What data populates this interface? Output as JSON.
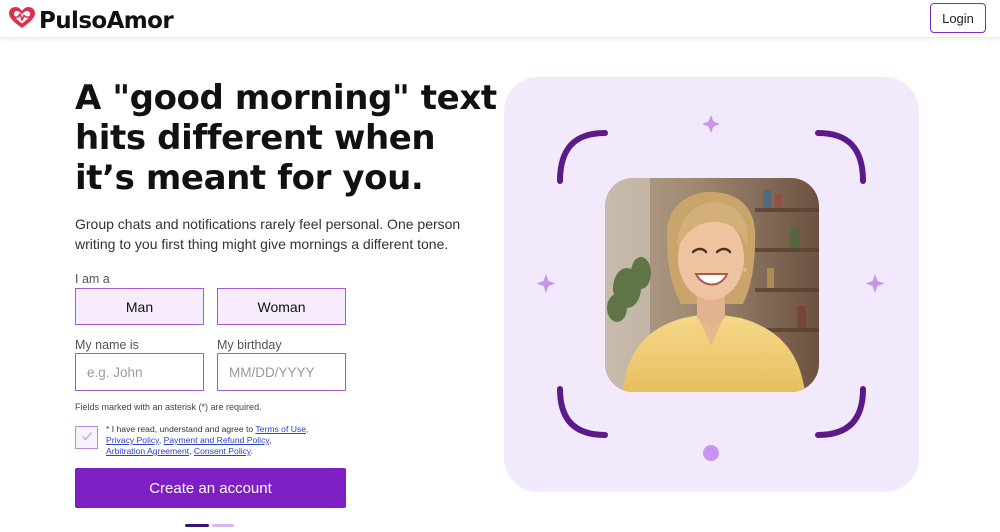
{
  "header": {
    "brand": "PulsoAmor",
    "login_label": "Login",
    "logo_icon": "heart-pulse-icon",
    "brand_color": "#e0304f"
  },
  "hero": {
    "headline": "A \"good morning\" text hits different when it’s meant for you.",
    "subtext": "Group chats and notifications rarely feel personal. One person writing to you first thing might give mornings a different tone."
  },
  "form": {
    "gender_label": "I am a",
    "gender_options": [
      "Man",
      "Woman"
    ],
    "name_label": "My name is",
    "name_placeholder": "e.g. John",
    "name_value": "",
    "birthday_label": "My birthday",
    "birthday_placeholder": "MM/DD/YYYY",
    "birthday_value": "",
    "required_note": "Fields marked with an asterisk (*) are required.",
    "agree_prefix": "* I have read, understand and agree to ",
    "links": {
      "terms": "Terms of Use",
      "privacy": "Privacy Policy",
      "payment": "Payment and Refund Policy",
      "arbitration": "Arbitration Agreement",
      "consent": "Consent Policy"
    },
    "agreement_checked": false,
    "submit_label": "Create an account",
    "accent_color": "#7e1fc6"
  },
  "steps": {
    "current": 1,
    "total": 2
  },
  "visual": {
    "background_color": "#f3e9fd",
    "bracket_color": "#5a1a8a",
    "sparkle_icon": "sparkle-icon",
    "photo": "smiling-woman-photo"
  }
}
